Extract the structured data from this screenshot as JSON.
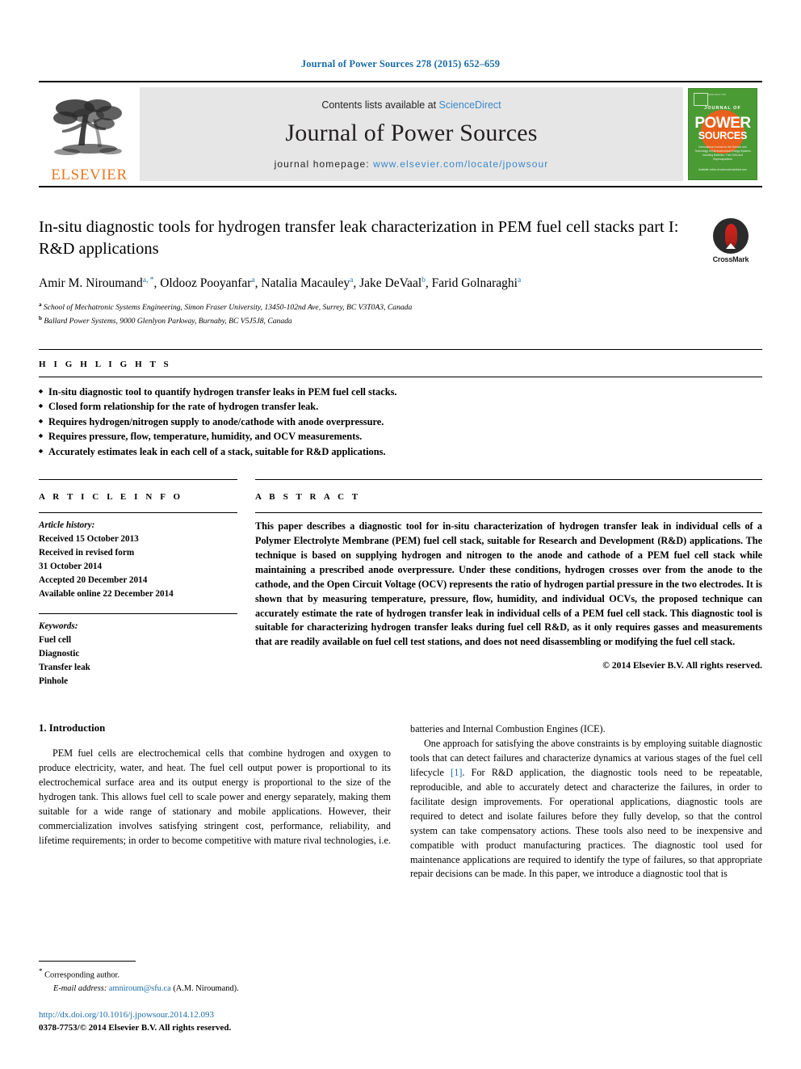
{
  "running_head": "Journal of Power Sources 278 (2015) 652–659",
  "masthead": {
    "publisher_name": "ELSEVIER",
    "contents_prefix": "Contents lists available at ",
    "sciencedirect": "ScienceDirect",
    "journal_name": "Journal of Power Sources",
    "homepage_prefix": "journal homepage: ",
    "homepage_url": "www.elsevier.com/locate/jpowsour",
    "cover": {
      "line1": "JOURNAL OF",
      "line2": "POWER",
      "line3": "SOURCES",
      "subtitle": "International Journal on the Science and Technology of Electrochemical Energy Systems including Batteries, Fuel Cells and Supercapacitors",
      "footer": "Available online at www.sciencedirect.com"
    }
  },
  "article": {
    "title": "In-situ diagnostic tools for hydrogen transfer leak characterization in PEM fuel cell stacks part I: R&D applications",
    "crossmark_label": "CrossMark",
    "authors": [
      {
        "name": "Amir M. Niroumand",
        "marks": "a, *",
        "sep": ", "
      },
      {
        "name": "Oldooz Pooyanfar",
        "marks": "a",
        "sep": ", "
      },
      {
        "name": "Natalia Macauley",
        "marks": "a",
        "sep": ", "
      },
      {
        "name": "Jake DeVaal",
        "marks": "b",
        "sep": ", "
      },
      {
        "name": "Farid Golnaraghi",
        "marks": "a",
        "sep": ""
      }
    ],
    "affiliations": [
      {
        "mark": "a",
        "text": "School of Mechatronic Systems Engineering, Simon Fraser University, 13450-102nd Ave, Surrey, BC V3T0A3, Canada"
      },
      {
        "mark": "b",
        "text": "Ballard Power Systems, 9000 Glenlyon Parkway, Burnaby, BC V5J5J8, Canada"
      }
    ]
  },
  "highlights": {
    "label": "H I G H L I G H T S",
    "items": [
      "In-situ diagnostic tool to quantify hydrogen transfer leaks in PEM fuel cell stacks.",
      "Closed form relationship for the rate of hydrogen transfer leak.",
      "Requires hydrogen/nitrogen supply to anode/cathode with anode overpressure.",
      "Requires pressure, flow, temperature, humidity, and OCV measurements.",
      "Accurately estimates leak in each cell of a stack, suitable for R&D applications."
    ]
  },
  "article_info": {
    "label": "A R T I C L E   I N F O",
    "history_label": "Article history:",
    "history": [
      "Received 15 October 2013",
      "Received in revised form",
      "31 October 2014",
      "Accepted 20 December 2014",
      "Available online 22 December 2014"
    ],
    "keywords_label": "Keywords:",
    "keywords": [
      "Fuel cell",
      "Diagnostic",
      "Transfer leak",
      "Pinhole"
    ]
  },
  "abstract": {
    "label": "A B S T R A C T",
    "text": "This paper describes a diagnostic tool for in-situ characterization of hydrogen transfer leak in individual cells of a Polymer Electrolyte Membrane (PEM) fuel cell stack, suitable for Research and Development (R&D) applications. The technique is based on supplying hydrogen and nitrogen to the anode and cathode of a PEM fuel cell stack while maintaining a prescribed anode overpressure. Under these conditions, hydrogen crosses over from the anode to the cathode, and the Open Circuit Voltage (OCV) represents the ratio of hydrogen partial pressure in the two electrodes. It is shown that by measuring temperature, pressure, flow, humidity, and individual OCVs, the proposed technique can accurately estimate the rate of hydrogen transfer leak in individual cells of a PEM fuel cell stack. This diagnostic tool is suitable for characterizing hydrogen transfer leaks during fuel cell R&D, as it only requires gasses and measurements that are readily available on fuel cell test stations, and does not need disassembling or modifying the fuel cell stack.",
    "copyright": "© 2014 Elsevier B.V. All rights reserved."
  },
  "body": {
    "section_heading": "1. Introduction",
    "left_paragraph": "PEM fuel cells are electrochemical cells that combine hydrogen and oxygen to produce electricity, water, and heat. The fuel cell output power is proportional to its electrochemical surface area and its output energy is proportional to the size of the hydrogen tank. This allows fuel cell to scale power and energy separately, making them suitable for a wide range of stationary and mobile applications. However, their commercialization involves satisfying stringent cost, performance, reliability, and lifetime requirements; in order to become competitive with mature rival technologies, i.e.",
    "right_continuation": "batteries and Internal Combustion Engines (ICE).",
    "right_paragraph_part1": "One approach for satisfying the above constraints is by employing suitable diagnostic tools that can detect failures and characterize dynamics at various stages of the fuel cell lifecycle ",
    "right_citation": "[1]",
    "right_paragraph_part2": ". For R&D application, the diagnostic tools need to be repeatable, reproducible, and able to accurately detect and characterize the failures, in order to facilitate design improvements. For operational applications, diagnostic tools are required to detect and isolate failures before they fully develop, so that the control system can take compensatory actions. These tools also need to be inexpensive and compatible with product manufacturing practices. The diagnostic tool used for maintenance applications are required to identify the type of failures, so that appropriate repair decisions can be made. In this paper, we introduce a diagnostic tool that is"
  },
  "footer": {
    "corresponding_star": "*",
    "corresponding_label": "Corresponding author.",
    "email_label": "E-mail address:",
    "email": "amniroum@sfu.ca",
    "email_suffix": "(A.M. Niroumand).",
    "doi": "http://dx.doi.org/10.1016/j.jpowsour.2014.12.093",
    "issn": "0378-7753/© 2014 Elsevier B.V. All rights reserved."
  },
  "colors": {
    "link_blue": "#1b6ca8",
    "sd_blue": "#3a87c8",
    "elsevier_orange": "#e87722",
    "cover_green": "#4b9b35",
    "banner_gray": "#e6e6e6"
  }
}
